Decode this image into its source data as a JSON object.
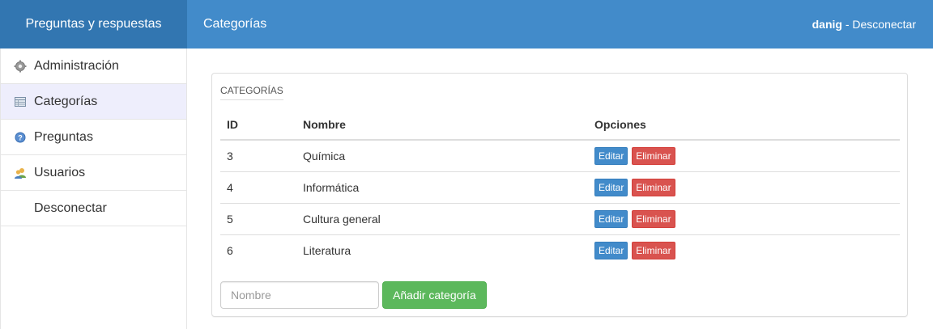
{
  "header": {
    "brand": "Preguntas y respuestas",
    "page_title": "Categorías",
    "username": "danig",
    "separator": " - ",
    "logout": "Desconectar"
  },
  "sidebar": {
    "items": [
      {
        "label": "Administración",
        "icon": "gear-icon",
        "active": false
      },
      {
        "label": "Categorías",
        "icon": "table-icon",
        "active": true
      },
      {
        "label": "Preguntas",
        "icon": "question-icon",
        "active": false
      },
      {
        "label": "Usuarios",
        "icon": "users-icon",
        "active": false
      },
      {
        "label": "Desconectar",
        "icon": null,
        "active": false
      }
    ]
  },
  "panel": {
    "title": "CATEGORÍAS",
    "columns": [
      "ID",
      "Nombre",
      "Opciones"
    ],
    "rows": [
      {
        "id": "3",
        "name": "Química"
      },
      {
        "id": "4",
        "name": "Informática"
      },
      {
        "id": "5",
        "name": "Cultura general"
      },
      {
        "id": "6",
        "name": "Literatura"
      }
    ],
    "edit_label": "Editar",
    "delete_label": "Eliminar",
    "input_placeholder": "Nombre",
    "add_label": "Añadir categoría"
  },
  "colors": {
    "topbar": "#428bca",
    "brand": "#3276b1",
    "edit": "#428bca",
    "delete": "#d9534f",
    "add": "#5cb85c"
  }
}
